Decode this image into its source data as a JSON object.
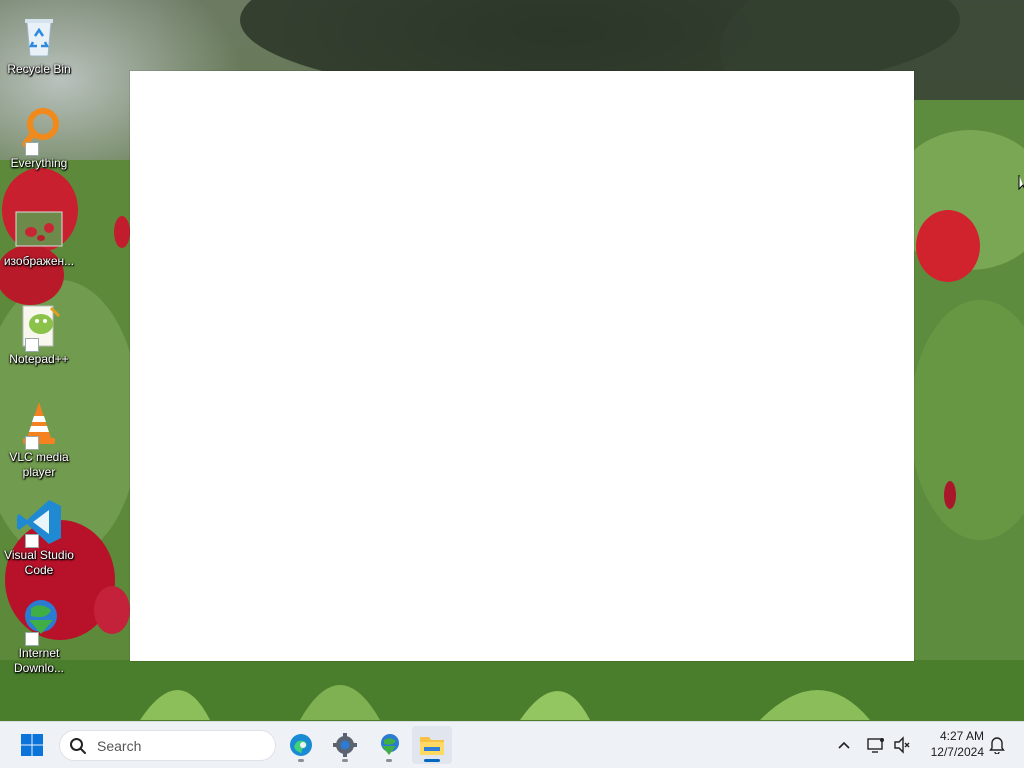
{
  "desktop": {
    "icons": [
      {
        "label": "Recycle Bin",
        "icon": "recycle-bin-icon"
      },
      {
        "label": "Everything",
        "icon": "everything-search-icon"
      },
      {
        "label": "изображен...",
        "icon": "image-file-icon"
      },
      {
        "label": "Notepad++",
        "icon": "notepad-plus-plus-icon"
      },
      {
        "label": "VLC media player",
        "icon": "vlc-cone-icon"
      },
      {
        "label": "Visual Studio Code",
        "icon": "vscode-icon"
      },
      {
        "label": "Internet Downlo...",
        "icon": "internet-download-manager-icon"
      }
    ]
  },
  "taskbar": {
    "search_placeholder": "Search",
    "pinned": [
      "start-icon",
      "edge-icon",
      "settings-gear-icon",
      "internet-download-manager-icon",
      "file-explorer-icon"
    ],
    "clock_time": "4:27 AM",
    "clock_date": "12/7/2024"
  },
  "colors": {
    "taskbar_bg": "#eef1f5",
    "accent": "#0067c0",
    "window_bg": "#ffffff"
  }
}
